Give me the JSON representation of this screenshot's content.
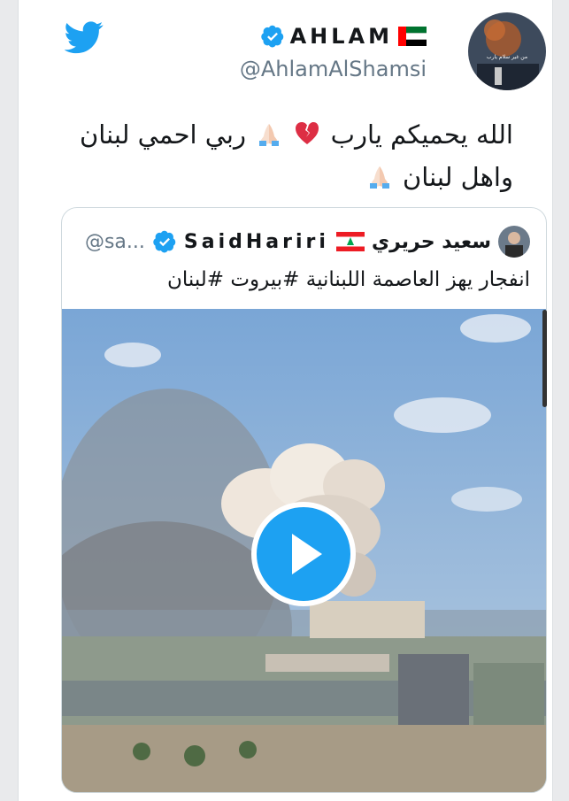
{
  "tweet": {
    "display_name": "AHLAM",
    "handle": "@AhlamAlShamsi",
    "text_line1": "الله يحميكم يارب",
    "text_line1b": "ربي احمي لبنان",
    "text_line2": "واهل لبنان",
    "avatar_caption": "من غير سلام يارب"
  },
  "quoted": {
    "name_ar": "سعيد حريري",
    "name_en": "SaidHariri",
    "handle": "@sa...",
    "text": "انفجار يهز العاصمة اللبنانية #بيروت #لبنان"
  },
  "colors": {
    "accent": "#1da1f2",
    "text": "#14171a",
    "secondary": "#657786"
  },
  "icons": [
    "twitter-bird-icon",
    "verified-badge-icon",
    "uae-flag-icon",
    "lebanon-flag-icon",
    "broken-heart-icon",
    "praying-hands-icon",
    "play-icon"
  ]
}
